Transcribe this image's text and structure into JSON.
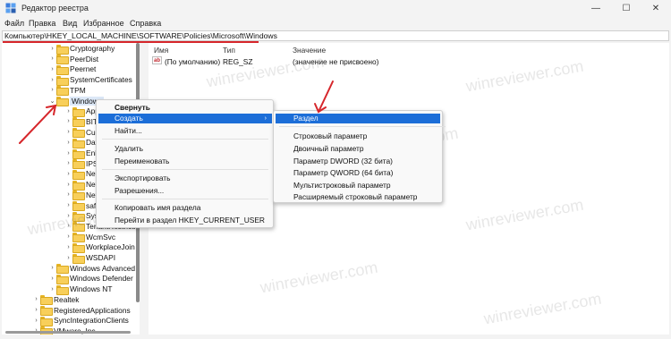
{
  "titlebar": {
    "title": "Редактор реестра",
    "minimize": "—",
    "maximize": "☐",
    "close": "✕"
  },
  "menubar": {
    "items": [
      "Файл",
      "Правка",
      "Вид",
      "Избранное",
      "Справка"
    ]
  },
  "address": {
    "path": "Компьютер\\HKEY_LOCAL_MACHINE\\SOFTWARE\\Policies\\Microsoft\\Windows"
  },
  "tree": {
    "items": [
      {
        "label": "Cryptography",
        "level": 1,
        "expanded": false
      },
      {
        "label": "PeerDist",
        "level": 1,
        "expanded": false
      },
      {
        "label": "Peernet",
        "level": 1,
        "expanded": false
      },
      {
        "label": "SystemCertificates",
        "level": 1,
        "expanded": false
      },
      {
        "label": "TPM",
        "level": 1,
        "expanded": false
      },
      {
        "label": "Windows",
        "level": 1,
        "expanded": true
      },
      {
        "label": "Appx",
        "level": 2,
        "expanded": false
      },
      {
        "label": "BITS",
        "level": 2,
        "expanded": false
      },
      {
        "label": "CurrentVersion",
        "level": 2,
        "expanded": false
      },
      {
        "label": "DataCollection",
        "level": 2,
        "expanded": false
      },
      {
        "label": "EnhancedStorageDevices",
        "level": 2,
        "expanded": false
      },
      {
        "label": "IPSec",
        "level": 2,
        "expanded": false
      },
      {
        "label": "Network Connections",
        "level": 2,
        "expanded": false
      },
      {
        "label": "NetworkConnectivityStatusIndicator",
        "level": 2,
        "expanded": false
      },
      {
        "label": "NetworkProvider",
        "level": 2,
        "expanded": false
      },
      {
        "label": "safer",
        "level": 2,
        "expanded": false
      },
      {
        "label": "System",
        "level": 2,
        "expanded": false
      },
      {
        "label": "TenantRestrictions",
        "level": 2,
        "expanded": false
      },
      {
        "label": "WcmSvc",
        "level": 2,
        "expanded": false
      },
      {
        "label": "WorkplaceJoin",
        "level": 2,
        "expanded": false
      },
      {
        "label": "WSDAPI",
        "level": 2,
        "expanded": false
      },
      {
        "label": "Windows Advanced Threat Protection",
        "level": 1,
        "expanded": false
      },
      {
        "label": "Windows Defender",
        "level": 1,
        "expanded": false
      },
      {
        "label": "Windows NT",
        "level": 1,
        "expanded": false
      },
      {
        "label": "Realtek",
        "level": 0,
        "expanded": false
      },
      {
        "label": "RegisteredApplications",
        "level": 0,
        "expanded": false
      },
      {
        "label": "SyncIntegrationClients",
        "level": 0,
        "expanded": false
      },
      {
        "label": "VMware, Inc.",
        "level": 0,
        "expanded": false
      }
    ]
  },
  "values": {
    "columns": [
      "Имя",
      "Тип",
      "Значение"
    ],
    "rows": [
      {
        "name": "(По умолчанию)",
        "type": "REG_SZ",
        "value": "(значение не присвоено)",
        "icon": "string-value-icon"
      }
    ]
  },
  "context_menu": {
    "items": [
      {
        "label": "Свернуть",
        "bold": true
      },
      {
        "label": "Создать",
        "active": true,
        "has_submenu": true
      },
      {
        "label": "Найти..."
      },
      {
        "label": "Удалить"
      },
      {
        "label": "Переименовать"
      },
      {
        "label": "Экспортировать"
      },
      {
        "label": "Разрешения..."
      },
      {
        "label": "Копировать имя раздела"
      },
      {
        "label": "Перейти в раздел HKEY_CURRENT_USER"
      }
    ],
    "submenu_arrow": "›"
  },
  "submenu": {
    "items": [
      {
        "label": "Раздел",
        "active": true
      },
      {
        "label": "Строковый параметр"
      },
      {
        "label": "Двоичный параметр"
      },
      {
        "label": "Параметр DWORD (32 бита)"
      },
      {
        "label": "Параметр QWORD (64 бита)"
      },
      {
        "label": "Мультистроковый параметр"
      },
      {
        "label": "Расширяемый строковый параметр"
      }
    ]
  },
  "colors": {
    "accent": "#1c6ed8",
    "annotation": "#d6262b",
    "folder": "#f8cf5a"
  },
  "watermark": "winreviewer.com"
}
